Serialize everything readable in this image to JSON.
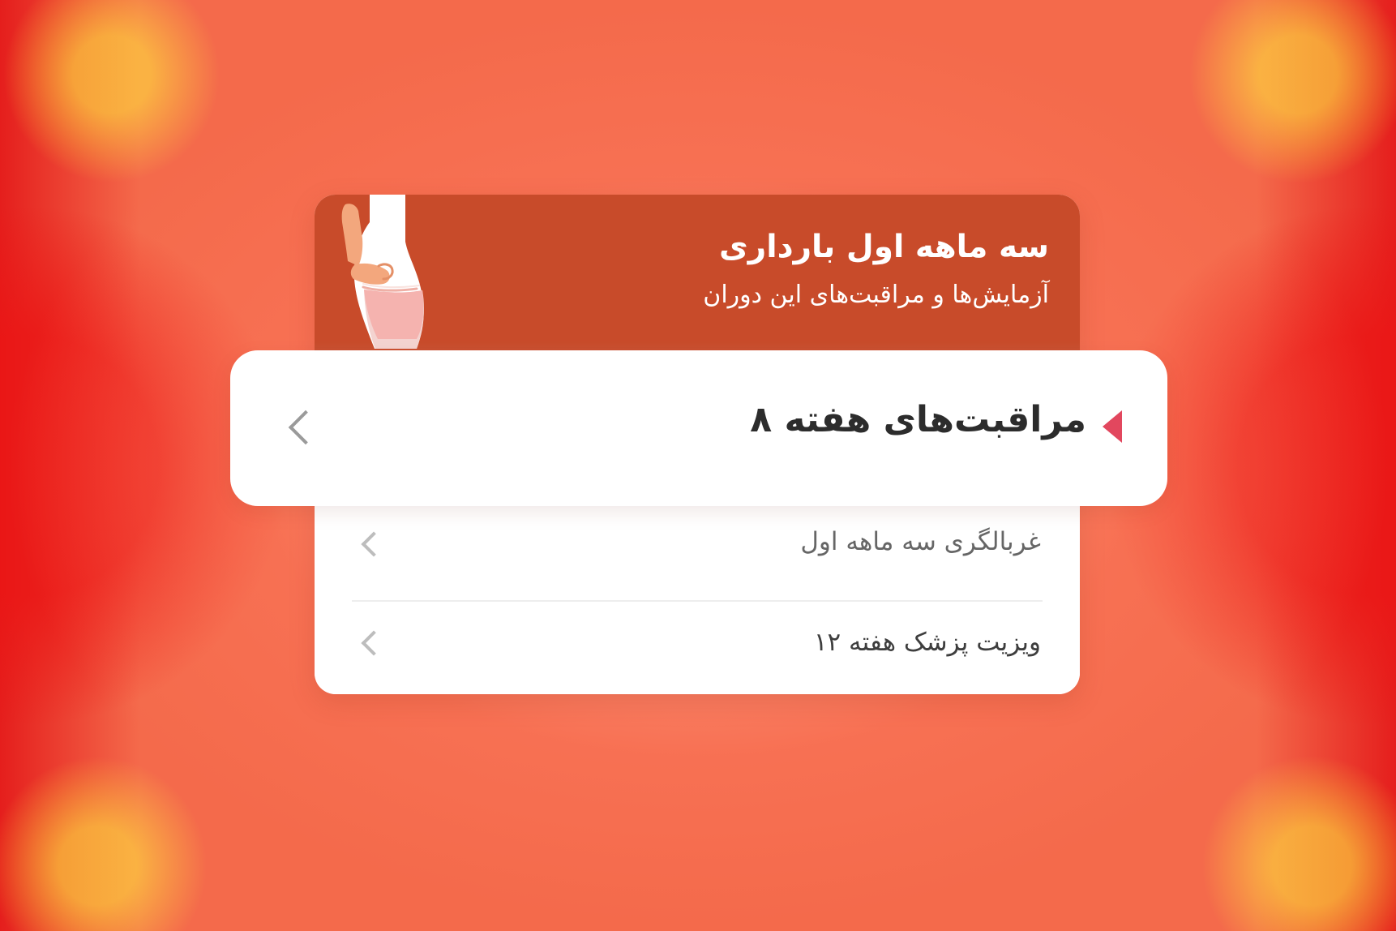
{
  "screen": {
    "background_color": "#f46a4b",
    "header_color": "#c84b2a",
    "accent_color": "#e2475e"
  },
  "card": {
    "header": {
      "title": "سه ماهه اول بارداری",
      "subtitle": "آزمایش‌ها و مراقبت‌های این دوران",
      "illustration_name": "pregnant-body-illustration"
    },
    "highlight_item": {
      "label": "مراقبت‌های هفته ۸",
      "marker_icon": "left-triangle-marker-icon",
      "chevron_icon": "chevron-left-icon"
    },
    "list_items": [
      {
        "label": "غربالگری سه ماهه اول",
        "chevron_icon": "chevron-left-icon"
      },
      {
        "label": "ویزیت پزشک هفته ۱۲",
        "chevron_icon": "chevron-left-icon"
      }
    ]
  }
}
